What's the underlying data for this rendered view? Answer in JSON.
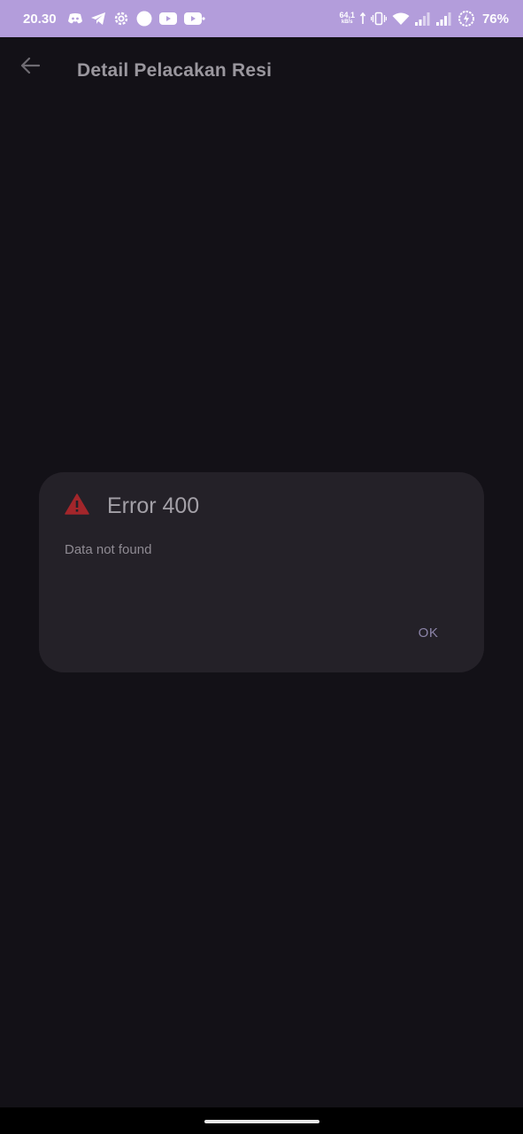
{
  "status_bar": {
    "time": "20.30",
    "netspeed_value": "64,1",
    "netspeed_unit": "kB/s",
    "battery": "76%",
    "left_icons": [
      "discord-icon",
      "telegram-icon",
      "settings-cog-icon",
      "circle-icon",
      "youtube-icon",
      "youtube-icon"
    ],
    "right_icons": [
      "upload-arrow-icon",
      "vibrate-icon",
      "wifi-icon",
      "signal-icon",
      "signal-icon",
      "battery-charging-icon"
    ],
    "background_color": "#b39ddb"
  },
  "app_bar": {
    "back_icon": "arrow-back-icon",
    "title": "Detail Pelacakan Resi"
  },
  "dialog": {
    "icon": "warning-triangle-icon",
    "icon_color": "#a3262b",
    "title": "Error 400",
    "message": "Data not found",
    "ok_label": "OK"
  },
  "theme": {
    "background": "#131117",
    "dialog_background": "#242128",
    "accent": "#8c84a8"
  }
}
